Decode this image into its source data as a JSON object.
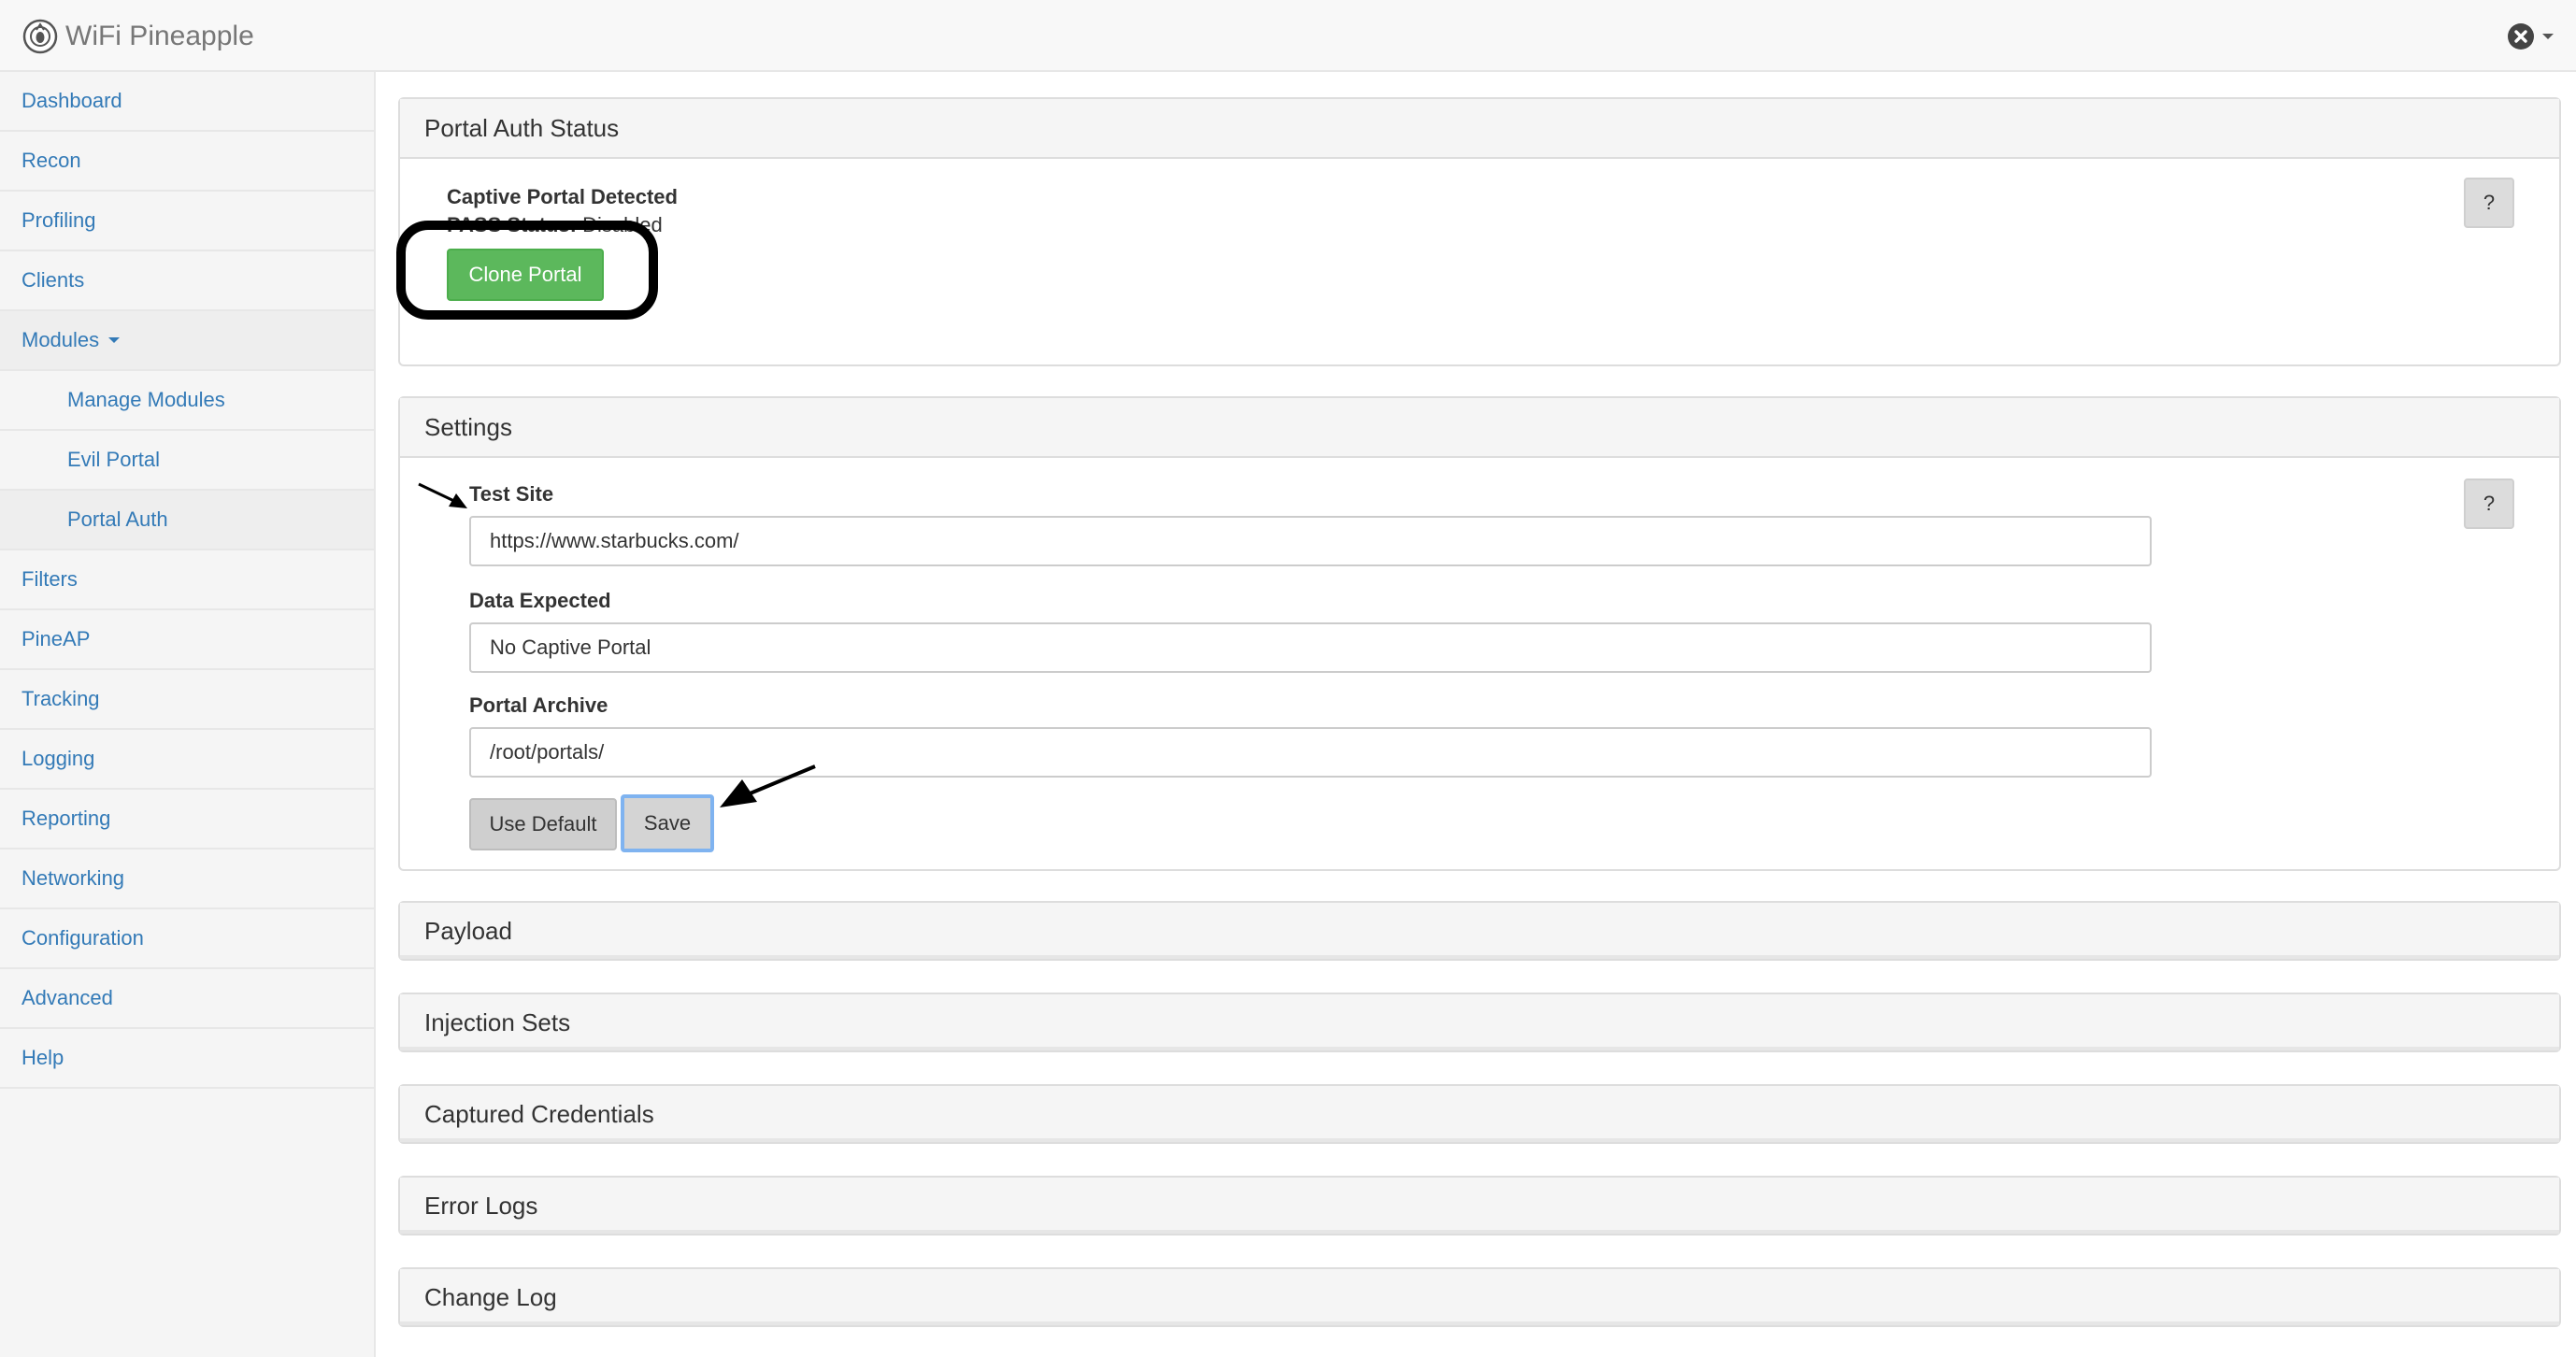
{
  "app": {
    "title": "WiFi Pineapple"
  },
  "sidebar": {
    "items": [
      {
        "label": "Dashboard"
      },
      {
        "label": "Recon"
      },
      {
        "label": "Profiling"
      },
      {
        "label": "Clients"
      },
      {
        "label": "Modules"
      },
      {
        "label": "Manage Modules"
      },
      {
        "label": "Evil Portal"
      },
      {
        "label": "Portal Auth"
      },
      {
        "label": "Filters"
      },
      {
        "label": "PineAP"
      },
      {
        "label": "Tracking"
      },
      {
        "label": "Logging"
      },
      {
        "label": "Reporting"
      },
      {
        "label": "Networking"
      },
      {
        "label": "Configuration"
      },
      {
        "label": "Advanced"
      },
      {
        "label": "Help"
      }
    ]
  },
  "status_panel": {
    "title": "Portal Auth Status",
    "detected": "Captive Portal Detected",
    "pass_label": "PASS Status:",
    "pass_value": "Disabled",
    "clone_label": "Clone Portal",
    "help_label": "?"
  },
  "settings_panel": {
    "title": "Settings",
    "help_label": "?",
    "test_site_label": "Test Site",
    "test_site_value": "https://www.starbucks.com/",
    "data_expected_label": "Data Expected",
    "data_expected_value": "No Captive Portal",
    "portal_archive_label": "Portal Archive",
    "portal_archive_value": "/root/portals/",
    "use_default_label": "Use Default",
    "save_label": "Save"
  },
  "collapsed_panels": [
    {
      "title": "Payload"
    },
    {
      "title": "Injection Sets"
    },
    {
      "title": "Captured Credentials"
    },
    {
      "title": "Error Logs"
    },
    {
      "title": "Change Log"
    }
  ],
  "colors": {
    "link": "#337ab7",
    "success": "#5cb85c",
    "focus_ring": "#7fb3f0"
  }
}
